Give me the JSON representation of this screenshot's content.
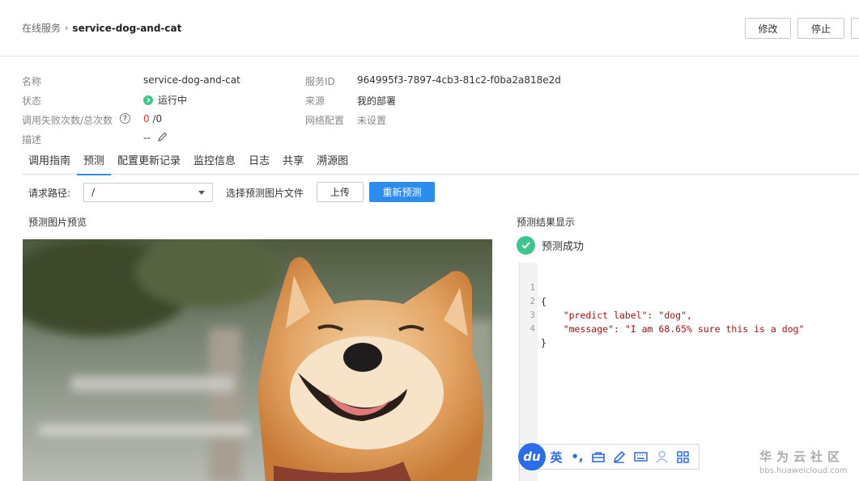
{
  "breadcrumb": {
    "parent": "在线服务",
    "separator": "›",
    "current": "service-dog-and-cat"
  },
  "toolbar": {
    "edit_label": "修改",
    "stop_label": "停止",
    "more_label": ""
  },
  "info": {
    "name_label": "名称",
    "name_value": "service-dog-and-cat",
    "status_label": "状态",
    "status_value": "运行中",
    "calls_label": "调用失败次数/总次数",
    "calls_fail": "0",
    "calls_total": "/0",
    "desc_label": "描述",
    "desc_value": "--",
    "service_id_label": "服务ID",
    "service_id_value": "964995f3-7897-4cb3-81c2-f0ba2a818e2d",
    "source_label": "来源",
    "source_value": "我的部署",
    "network_label": "网络配置",
    "network_value": "未设置"
  },
  "tabs": [
    {
      "label": "调用指南"
    },
    {
      "label": "预测",
      "active": true
    },
    {
      "label": "配置更新记录"
    },
    {
      "label": "监控信息"
    },
    {
      "label": "日志"
    },
    {
      "label": "共享"
    },
    {
      "label": "溯源图"
    }
  ],
  "predict": {
    "path_label": "请求路径:",
    "path_value": "/",
    "choose_label": "选择预测图片文件",
    "upload_label": "上传",
    "repredict_label": "重新预测",
    "preview_title": "预测图片预览",
    "result_title": "预测结果显示",
    "success_label": "预测成功"
  },
  "code": {
    "lines": [
      {
        "num": "1",
        "text": "{"
      },
      {
        "num": "2",
        "text": "    \"predict label\": \"dog\","
      },
      {
        "num": "3",
        "text": "    \"message\": \"I am 68.65% sure this is a dog\""
      },
      {
        "num": "4",
        "text": "}"
      }
    ]
  },
  "ime": {
    "logo": "du",
    "lang": "英",
    "punct": "•,"
  },
  "watermark": {
    "title": "华为云社区",
    "url": "bbs.huaweicloud.com"
  },
  "colors": {
    "accent": "#2d8cf0",
    "success": "#3ec48d",
    "danger": "#e53935"
  }
}
